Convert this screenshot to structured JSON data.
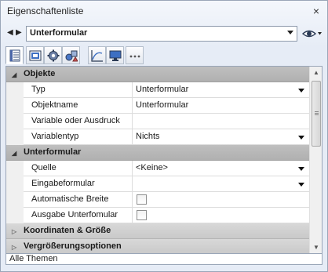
{
  "window": {
    "title": "Eigenschaftenliste"
  },
  "nav": {
    "selected_object": "Unterformular"
  },
  "toolbar": {
    "tabs": [
      {
        "icon": "property-list-icon",
        "active": true
      },
      {
        "icon": "form-icon",
        "active": false
      },
      {
        "icon": "gear-icon",
        "active": false
      },
      {
        "icon": "shapes-icon",
        "active": false
      },
      {
        "icon": "chart-icon",
        "active": false
      },
      {
        "icon": "monitor-icon",
        "active": false
      },
      {
        "icon": "more-icon",
        "active": false
      }
    ]
  },
  "sections": {
    "objekte": {
      "label": "Objekte",
      "rows": {
        "typ": {
          "name": "Typ",
          "value": "Unterformular"
        },
        "objektname": {
          "name": "Objektname",
          "value": "Unterformular"
        },
        "variable": {
          "name": "Variable oder Ausdruck",
          "value": ""
        },
        "variablentyp": {
          "name": "Variablentyp",
          "value": "Nichts"
        }
      }
    },
    "unterformular": {
      "label": "Unterformular",
      "rows": {
        "quelle": {
          "name": "Quelle",
          "value": "<Keine>"
        },
        "eingabeformular": {
          "name": "Eingabeformular",
          "value": ""
        },
        "automatische_breite": {
          "name": "Automatische Breite",
          "checked": false
        },
        "ausgabe_unterformular": {
          "name": "Ausgabe Unterfomular",
          "checked": false
        }
      }
    },
    "koordinaten": {
      "label": "Koordinaten & Größe"
    },
    "vergroesserung": {
      "label": "Vergrößerungsoptionen"
    }
  },
  "status": {
    "theme_filter": "Alle Themen"
  }
}
